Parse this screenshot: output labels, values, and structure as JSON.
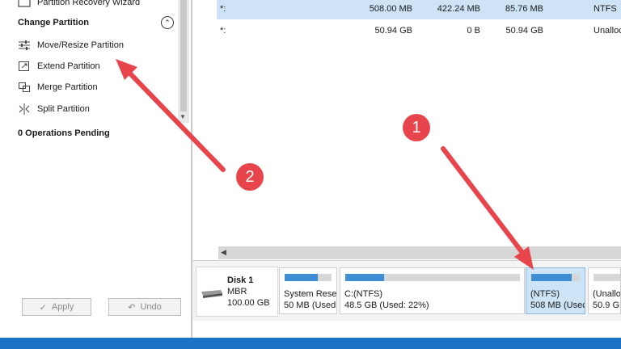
{
  "sidebar": {
    "recovery_item": "Partition Recovery Wizard",
    "section_title": "Change Partition",
    "items": [
      {
        "label": "Move/Resize Partition",
        "icon": "sliders-icon"
      },
      {
        "label": "Extend Partition",
        "icon": "extend-icon"
      },
      {
        "label": "Merge Partition",
        "icon": "merge-icon"
      },
      {
        "label": "Split Partition",
        "icon": "split-icon"
      }
    ],
    "pending": "0 Operations Pending",
    "apply_label": "Apply",
    "undo_label": "Undo"
  },
  "table": {
    "rows": [
      {
        "name": "*:",
        "capacity": "508.00 MB",
        "used": "422.24 MB",
        "unused": "85.76 MB",
        "fs": "NTFS",
        "selected": true
      },
      {
        "name": "*:",
        "capacity": "50.94 GB",
        "used": "0 B",
        "unused": "50.94 GB",
        "fs": "Unallocat",
        "selected": false
      }
    ]
  },
  "disk": {
    "name": "Disk 1",
    "type": "MBR",
    "size": "100.00 GB",
    "partitions": [
      {
        "line1": "System Reser",
        "line2": "50 MB (Used:",
        "used_fraction": 0.7
      },
      {
        "line1": "C:(NTFS)",
        "line2": "48.5 GB (Used: 22%)",
        "used_fraction": 0.22
      },
      {
        "line1": "(NTFS)",
        "line2": "508 MB (Usec",
        "used_fraction": 0.83
      },
      {
        "line1": "(Unallo",
        "line2": "50.9 GB",
        "used_fraction": 0
      }
    ]
  },
  "annotations": {
    "badge1": "1",
    "badge2": "2",
    "colors": {
      "arrow": "#e8444c",
      "accent": "#3d8ed4",
      "selected": "#cde4f6"
    }
  }
}
